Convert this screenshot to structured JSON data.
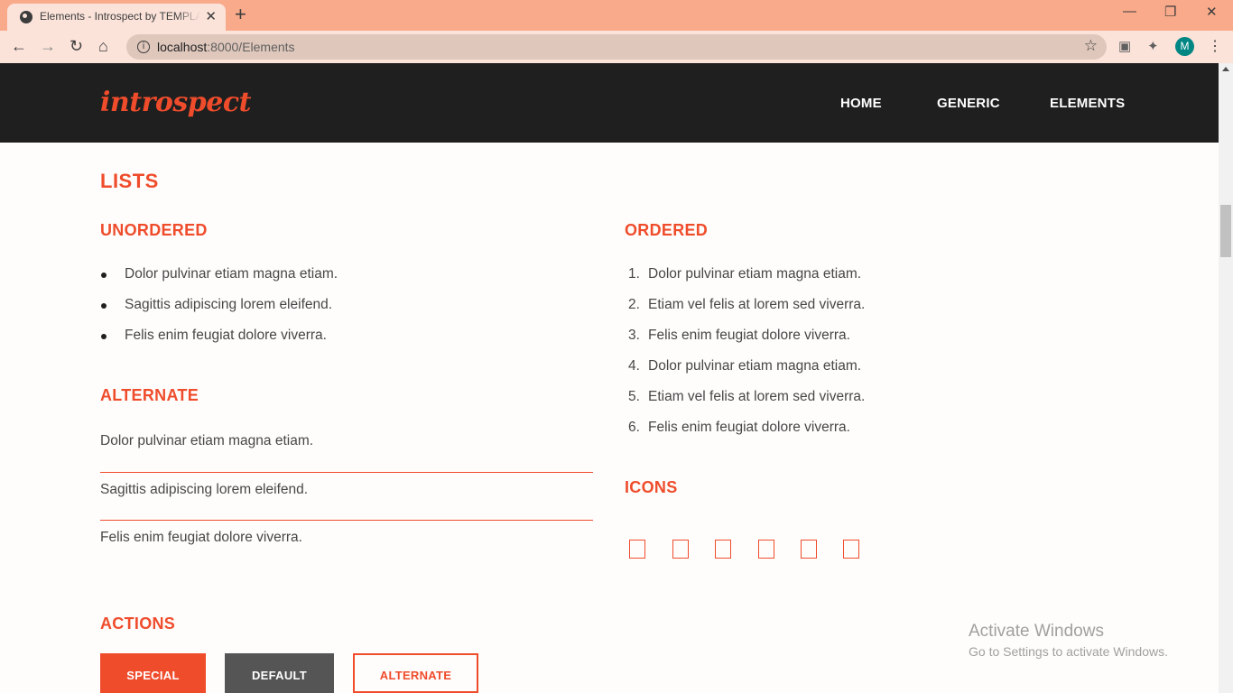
{
  "browser": {
    "tab_title": "Elements - Introspect by TEMPLATED",
    "tab_close": "✕",
    "new_tab": "+",
    "url_host": "localhost",
    "url_path": ":8000/Elements",
    "avatar_letter": "M",
    "window_controls": {
      "minimize": "—",
      "restore": "❐",
      "close": "✕"
    }
  },
  "site": {
    "logo": "introspect",
    "nav": [
      "HOME",
      "GENERIC",
      "ELEMENTS"
    ]
  },
  "lists": {
    "title": "LISTS",
    "unordered": {
      "title": "UNORDERED",
      "items": [
        "Dolor pulvinar etiam magna etiam.",
        "Sagittis adipiscing lorem eleifend.",
        "Felis enim feugiat dolore viverra."
      ]
    },
    "alternate": {
      "title": "ALTERNATE",
      "items": [
        "Dolor pulvinar etiam magna etiam.",
        "Sagittis adipiscing lorem eleifend.",
        "Felis enim feugiat dolore viverra."
      ]
    },
    "ordered": {
      "title": "ORDERED",
      "items": [
        "Dolor pulvinar etiam magna etiam.",
        "Etiam vel felis at lorem sed viverra.",
        "Felis enim feugiat dolore viverra.",
        "Dolor pulvinar etiam magna etiam.",
        "Etiam vel felis at lorem sed viverra.",
        "Felis enim feugiat dolore viverra."
      ]
    },
    "icons": {
      "title": "ICONS",
      "items": [
        "missing-glyph-icon",
        "missing-glyph-icon",
        "missing-glyph-icon",
        "missing-glyph-icon",
        "missing-glyph-icon",
        "missing-glyph-icon"
      ]
    }
  },
  "actions": {
    "title": "ACTIONS",
    "buttons": [
      "SPECIAL",
      "DEFAULT",
      "ALTERNATE"
    ]
  },
  "watermark": {
    "title": "Activate Windows",
    "subtitle": "Go to Settings to activate Windows."
  },
  "colors": {
    "accent": "#ef4c2c",
    "header_bg": "#1f1f1f",
    "tabstrip": "#f9aa8b",
    "toolbar": "#fbe3da"
  }
}
